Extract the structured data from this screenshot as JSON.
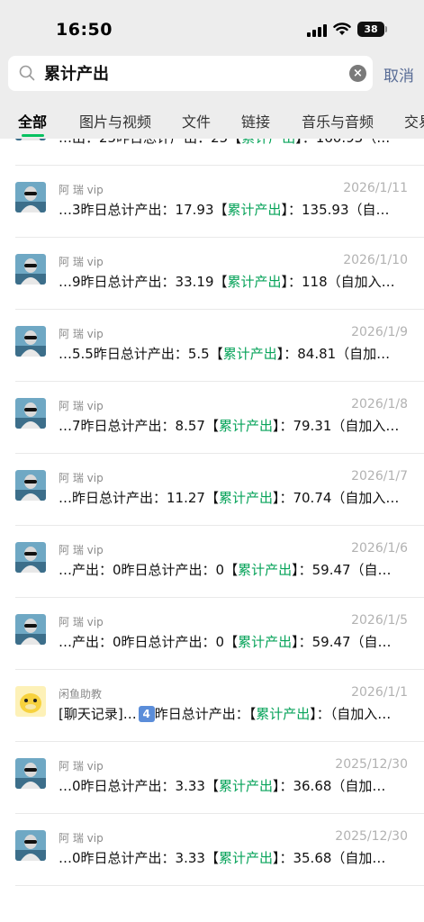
{
  "status_bar": {
    "time": "16:50",
    "battery": "38"
  },
  "search": {
    "query": "累计产出",
    "cancel_label": "取消"
  },
  "tabs": [
    {
      "label": "全部",
      "active": true
    },
    {
      "label": "图片与视频"
    },
    {
      "label": "文件"
    },
    {
      "label": "链接"
    },
    {
      "label": "音乐与音频"
    },
    {
      "label": "交易"
    }
  ],
  "results": [
    {
      "sender": "",
      "date": "",
      "pre": "…出：25昨日总计产出：25【",
      "hl": "累计产出",
      "post": "】：160.93（…",
      "avatar": "person-icon"
    },
    {
      "sender": "阿 瑞 vip",
      "date": "2026/1/11",
      "pre": "…3昨日总计产出：17.93【",
      "hl": "累计产出",
      "post": "】：135.93（自…",
      "avatar": "person-icon"
    },
    {
      "sender": "阿 瑞 vip",
      "date": "2026/1/10",
      "pre": "…9昨日总计产出：33.19【",
      "hl": "累计产出",
      "post": "】：118（自加入…",
      "avatar": "person-icon"
    },
    {
      "sender": "阿 瑞 vip",
      "date": "2026/1/9",
      "pre": "…5.5昨日总计产出：5.5【",
      "hl": "累计产出",
      "post": "】：84.81（自加…",
      "avatar": "person-icon"
    },
    {
      "sender": "阿 瑞 vip",
      "date": "2026/1/8",
      "pre": "…7昨日总计产出：8.57【",
      "hl": "累计产出",
      "post": "】：79.31（自加入…",
      "avatar": "person-icon"
    },
    {
      "sender": "阿 瑞 vip",
      "date": "2026/1/7",
      "pre": "…昨日总计产出：11.27【",
      "hl": "累计产出",
      "post": "】：70.74（自加入…",
      "avatar": "person-icon"
    },
    {
      "sender": "阿 瑞 vip",
      "date": "2026/1/6",
      "pre": "…产出：0昨日总计产出：0【",
      "hl": "累计产出",
      "post": "】：59.47（自…",
      "avatar": "person-icon"
    },
    {
      "sender": "阿 瑞 vip",
      "date": "2026/1/5",
      "pre": "…产出：0昨日总计产出：0【",
      "hl": "累计产出",
      "post": "】：59.47（自…",
      "avatar": "person-icon"
    },
    {
      "sender": "闲鱼助教",
      "date": "2026/1/1",
      "pre": "[聊天记录]…",
      "num": "4",
      "pre2": "昨日总计产出：【",
      "hl": "累计产出",
      "post": "】：（自加入…",
      "avatar": "duck-icon"
    },
    {
      "sender": "阿 瑞 vip",
      "date": "2025/12/30",
      "pre": "…0昨日总计产出：3.33【",
      "hl": "累计产出",
      "post": "】：36.68（自加…",
      "avatar": "person-icon"
    },
    {
      "sender": "阿 瑞 vip",
      "date": "2025/12/30",
      "pre": "…0昨日总计产出：3.33【",
      "hl": "累计产出",
      "post": "】：35.68（自加…",
      "avatar": "person-icon"
    }
  ],
  "colors": {
    "highlight": "#07a35a",
    "accent_link": "#576b95",
    "tab_underline": "#07c160"
  }
}
